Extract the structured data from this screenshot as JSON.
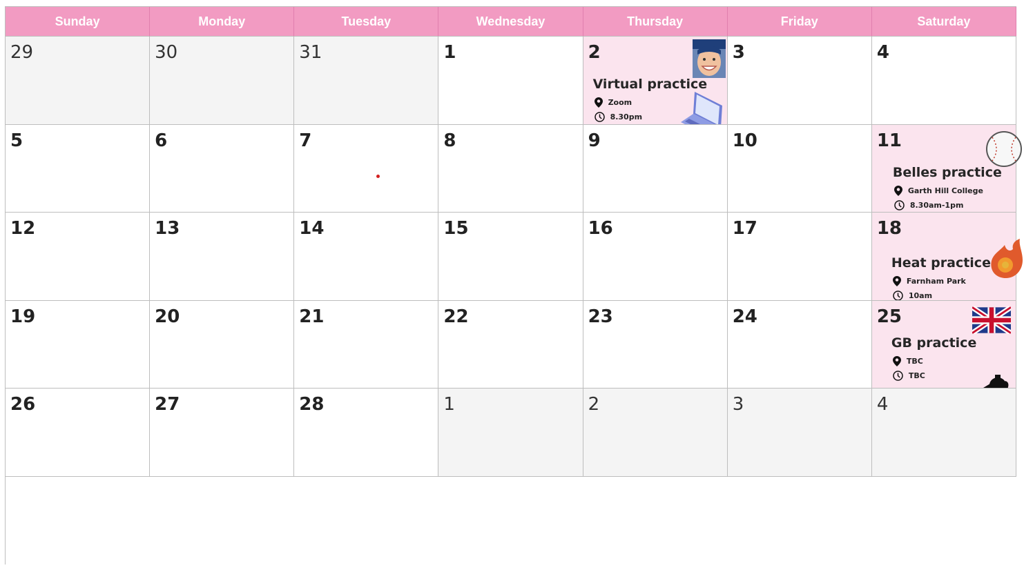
{
  "weekdays": [
    "Sunday",
    "Monday",
    "Tuesday",
    "Wednesday",
    "Thursday",
    "Friday",
    "Saturday"
  ],
  "weeks": [
    [
      "29",
      "30",
      "31",
      "1",
      "2",
      "3",
      "4"
    ],
    [
      "5",
      "6",
      "7",
      "8",
      "9",
      "10",
      "11"
    ],
    [
      "12",
      "13",
      "14",
      "15",
      "16",
      "17",
      "18"
    ],
    [
      "19",
      "20",
      "21",
      "22",
      "23",
      "24",
      "25"
    ],
    [
      "26",
      "27",
      "28",
      "1",
      "2",
      "3",
      "4"
    ]
  ],
  "events": {
    "virtual": {
      "title": "Virtual practice",
      "location": "Zoom",
      "time": "8.30pm"
    },
    "belles": {
      "title": "Belles practice",
      "location": "Garth Hill College",
      "time": "8.30am-1pm"
    },
    "heat": {
      "title": "Heat practice",
      "location": "Farnham Park",
      "time": "10am"
    },
    "gb": {
      "title": "GB practice",
      "location": "TBC",
      "time": "TBC"
    }
  },
  "icons": [
    "location-pin-icon",
    "clock-icon",
    "avatar-photo",
    "laptop-icon",
    "baseball-icon",
    "flame-icon",
    "union-jack-flag-icon",
    "teapot-icon"
  ],
  "colors": {
    "header": "#f29bc2",
    "event_bg": "#fbe4ee",
    "other_month_bg": "#f4f4f4"
  }
}
